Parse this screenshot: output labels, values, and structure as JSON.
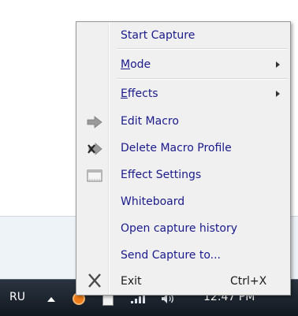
{
  "menu": {
    "items": [
      {
        "label": "Start Capture"
      },
      {
        "label_first": "M",
        "label_rest": "ode",
        "has_submenu": true
      },
      {
        "label_first": "E",
        "label_rest": "ffects",
        "has_submenu": true
      },
      {
        "label": "Edit Macro",
        "icon": "arrow-right-icon"
      },
      {
        "label": "Delete Macro Profile",
        "icon": "delete-macro-icon"
      },
      {
        "label": "Effect Settings",
        "icon": "window-settings-icon"
      },
      {
        "label": "Whiteboard"
      },
      {
        "label": "Open capture history"
      },
      {
        "label": "Send Capture to..."
      },
      {
        "label": "Exit",
        "shortcut": "Ctrl+X",
        "icon": "close-x-icon"
      }
    ]
  },
  "taskbar": {
    "language": "RU",
    "clock": "12:47 PM"
  },
  "colors": {
    "menu_background": "#f0f0f0",
    "taskbar": "#1a222b",
    "app_icon": "#f07d1a"
  }
}
